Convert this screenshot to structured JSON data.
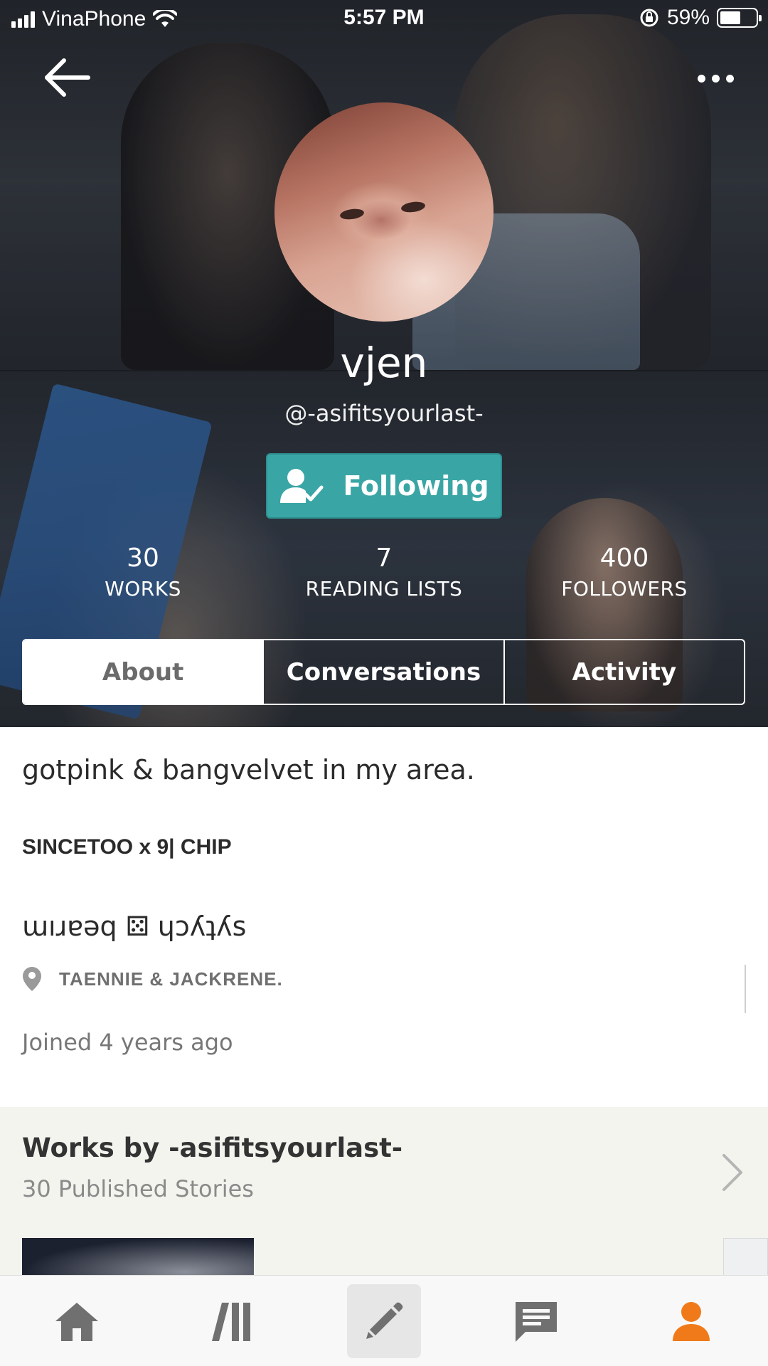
{
  "status_bar": {
    "carrier": "VinaPhone",
    "time": "5:57 PM",
    "battery": "59%",
    "battery_level": 0.59
  },
  "profile": {
    "display_name": "vjen",
    "username": "@-asifitsyourlast-",
    "follow_button": "Following"
  },
  "stats": [
    {
      "value": "30",
      "label": "WORKS"
    },
    {
      "value": "7",
      "label": "READING LISTS"
    },
    {
      "value": "400",
      "label": "FOLLOWERS"
    }
  ],
  "tabs": [
    {
      "label": "About",
      "active": true
    },
    {
      "label": "Conversations",
      "active": false
    },
    {
      "label": "Activity",
      "active": false
    }
  ],
  "about": {
    "bio": "gotpink & bangvelvet in my area.",
    "line2": "SINCETOO x 9| CHIP",
    "line3": "ɯıɹɐǝq ⚄ ɥɔʎʇʎs",
    "location": "TAENNIE & JACKRENE.",
    "joined": "Joined 4 years ago"
  },
  "works": {
    "title": "Works by -asifitsyourlast-",
    "subtitle": "30 Published Stories"
  },
  "bottom_nav": [
    {
      "icon": "home-icon",
      "active": false
    },
    {
      "icon": "library-icon",
      "active": false
    },
    {
      "icon": "write-icon",
      "active": false
    },
    {
      "icon": "messages-icon",
      "active": false
    },
    {
      "icon": "profile-icon",
      "active": true
    }
  ],
  "colors": {
    "accent_teal": "#3aa5a5",
    "active_orange": "#f07a1a",
    "nav_gray": "#707070"
  }
}
